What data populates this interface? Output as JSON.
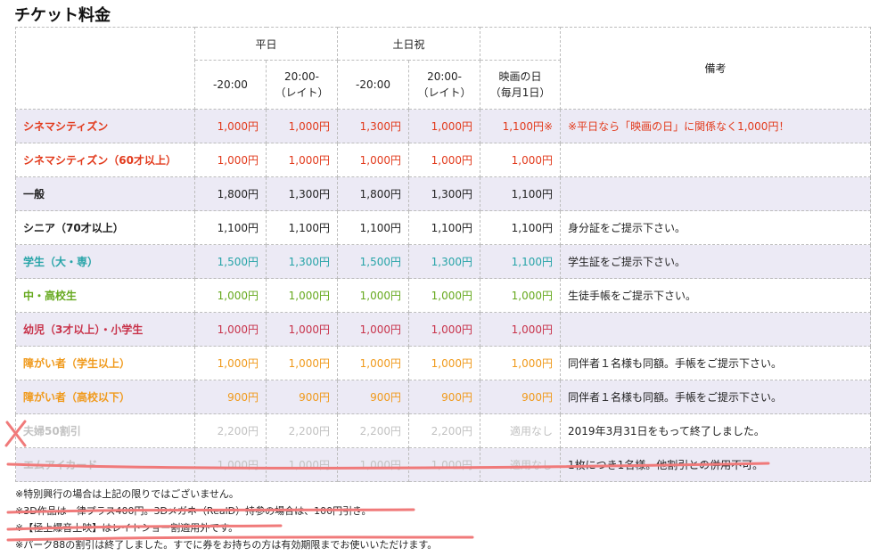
{
  "title": "チケット料金",
  "header": {
    "weekday": "平日",
    "holiday": "土日祝",
    "remarks": "備考",
    "cols": [
      "-20:00",
      "20:00-\n（レイト）",
      "-20:00",
      "20:00-\n（レイト）",
      "映画の日\n（毎月1日）"
    ]
  },
  "rows": [
    {
      "label": "シネマシティズン",
      "v": [
        "1,000円",
        "1,000円",
        "1,300円",
        "1,000円",
        "1,100円※"
      ],
      "note": "※平日なら「映画の日」に関係なく1,000円！"
    },
    {
      "label": "シネマシティズン（60才以上）",
      "v": [
        "1,000円",
        "1,000円",
        "1,000円",
        "1,000円",
        "1,000円"
      ],
      "note": ""
    },
    {
      "label": "一般",
      "v": [
        "1,800円",
        "1,300円",
        "1,800円",
        "1,300円",
        "1,100円"
      ],
      "note": ""
    },
    {
      "label": "シニア（70才以上）",
      "v": [
        "1,100円",
        "1,100円",
        "1,100円",
        "1,100円",
        "1,100円"
      ],
      "note": "身分証をご提示下さい。"
    },
    {
      "label": "学生（大・専）",
      "v": [
        "1,500円",
        "1,300円",
        "1,500円",
        "1,300円",
        "1,100円"
      ],
      "note": "学生証をご提示下さい。"
    },
    {
      "label": "中・高校生",
      "v": [
        "1,000円",
        "1,000円",
        "1,000円",
        "1,000円",
        "1,000円"
      ],
      "note": "生徒手帳をご提示下さい。"
    },
    {
      "label": "幼児（3才以上）・小学生",
      "v": [
        "1,000円",
        "1,000円",
        "1,000円",
        "1,000円",
        "1,000円"
      ],
      "note": ""
    },
    {
      "label": "障がい者（学生以上）",
      "v": [
        "1,000円",
        "1,000円",
        "1,000円",
        "1,000円",
        "1,000円"
      ],
      "note": "同伴者１名様も同額。手帳をご提示下さい。"
    },
    {
      "label": "障がい者（高校以下）",
      "v": [
        "900円",
        "900円",
        "900円",
        "900円",
        "900円"
      ],
      "note": "同伴者１名様も同額。手帳をご提示下さい。"
    },
    {
      "label": "夫婦50割引",
      "v": [
        "2,200円",
        "2,200円",
        "2,200円",
        "2,200円",
        "適用なし"
      ],
      "note": "2019年3月31日をもって終了しました。"
    },
    {
      "label": "エムアイカード",
      "v": [
        "1,000円",
        "1,000円",
        "1,000円",
        "1,000円",
        "適用なし"
      ],
      "note": "1枚につき1名様。他割引との併用不可。"
    }
  ],
  "notes": [
    "※特別興行の場合は上記の限りではございません。",
    "※3D作品は一律プラス400円。3Dメガネ（RealD）持参の場合は、100円引き。",
    "※【極上爆音上映】はレイトショー割適用外です。",
    "※パーク88の割引は終了しました。すでに券をお持ちの方は有効期限までお使いいただけます。"
  ],
  "colors": {
    "stripe": "#eceaf5",
    "red": "#e23a1c",
    "teal": "#27a4a8",
    "green": "#66a91e",
    "crimson": "#c8334b",
    "orange": "#f09a1c",
    "gray": "#c2c2c2",
    "annotation": "#f07a7a"
  }
}
